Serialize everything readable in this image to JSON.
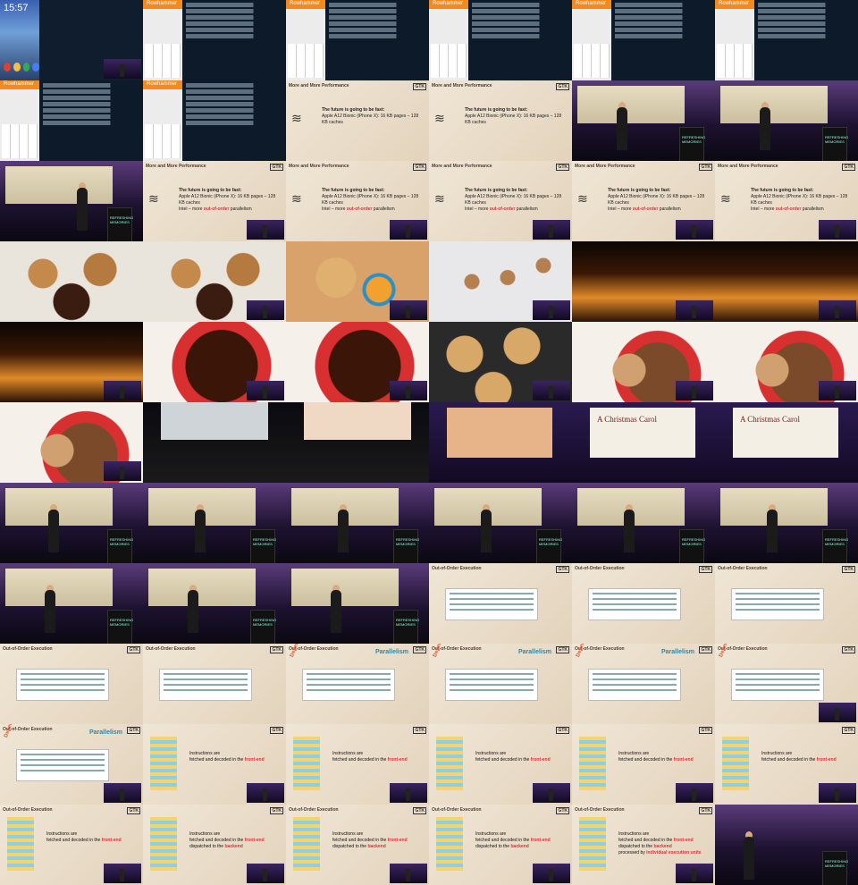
{
  "phone": {
    "time": "15:57"
  },
  "kbd_bar_label": "Rowhammer",
  "slide_titles": {
    "perf": "More and More Performance",
    "ooo": "Out-of-Order Execution"
  },
  "slide_text": {
    "future": "The future is going to be fast:",
    "apple": "Apple A12 Bionic (iPhone X): 16 KB pages – 128 KB caches",
    "intel_pre": "Intel – more",
    "intel_red": "out-of-order",
    "intel_post": "parallelism",
    "parallelism": "Parallelism",
    "dependency": "Dependency",
    "inst_head": "Instructions are",
    "inst_fetch": "fetched and decoded in the",
    "front_end": "front-end",
    "dispatch": "dispatched to the",
    "backend": "backend",
    "processed": "processed by",
    "units": "individual execution units"
  },
  "logo": "GTK",
  "podium": "REFRESHING MEMORIES",
  "carol": {
    "title": "A Christmas Carol"
  }
}
